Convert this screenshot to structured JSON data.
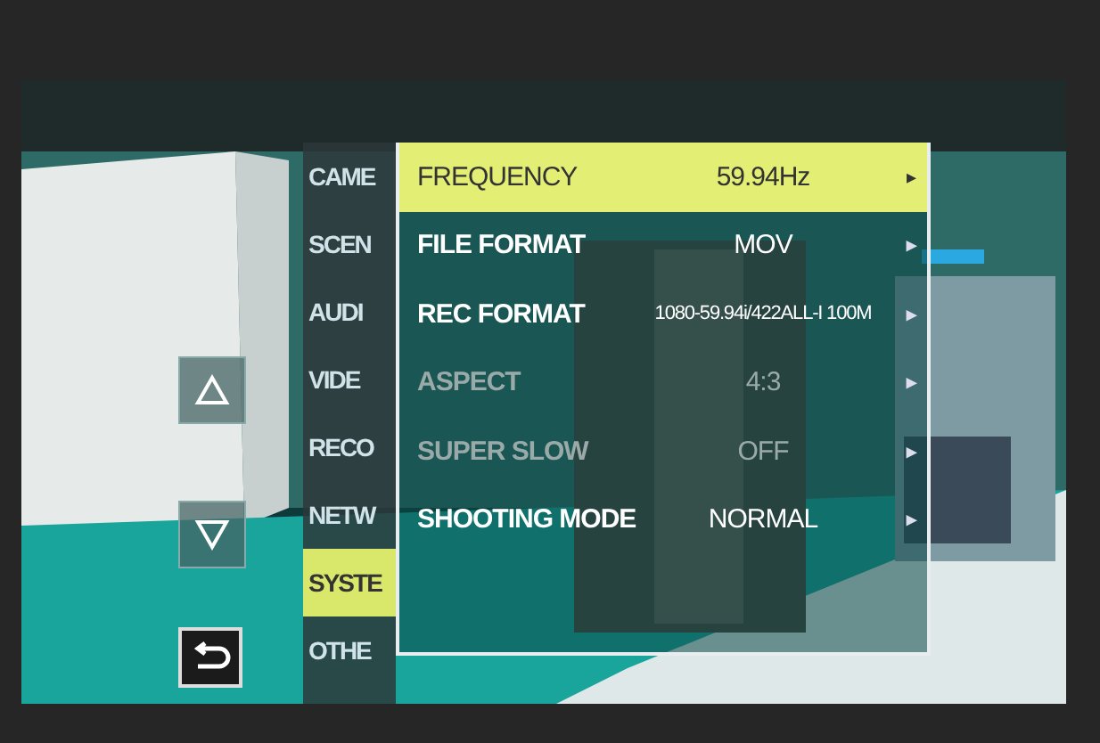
{
  "categories": [
    {
      "label": "CAME",
      "selected": false
    },
    {
      "label": "SCEN",
      "selected": false
    },
    {
      "label": "AUDI",
      "selected": false
    },
    {
      "label": "VIDE",
      "selected": false
    },
    {
      "label": "RECO",
      "selected": false
    },
    {
      "label": "NETW",
      "selected": false
    },
    {
      "label": "SYSTE",
      "selected": true
    },
    {
      "label": "OTHE",
      "selected": false
    }
  ],
  "settings": [
    {
      "label": "FREQUENCY",
      "value": "59.94Hz",
      "selected": true,
      "disabled": false
    },
    {
      "label": "FILE FORMAT",
      "value": "MOV",
      "selected": false,
      "disabled": false
    },
    {
      "label": "REC FORMAT",
      "value": "1080-59.94i/422ALL-I 100M",
      "selected": false,
      "disabled": false
    },
    {
      "label": "ASPECT",
      "value": "4:3",
      "selected": false,
      "disabled": true
    },
    {
      "label": "SUPER SLOW",
      "value": "OFF",
      "selected": false,
      "disabled": true
    },
    {
      "label": "SHOOTING MODE",
      "value": "NORMAL",
      "selected": false,
      "disabled": false
    }
  ],
  "arrow": "▸"
}
